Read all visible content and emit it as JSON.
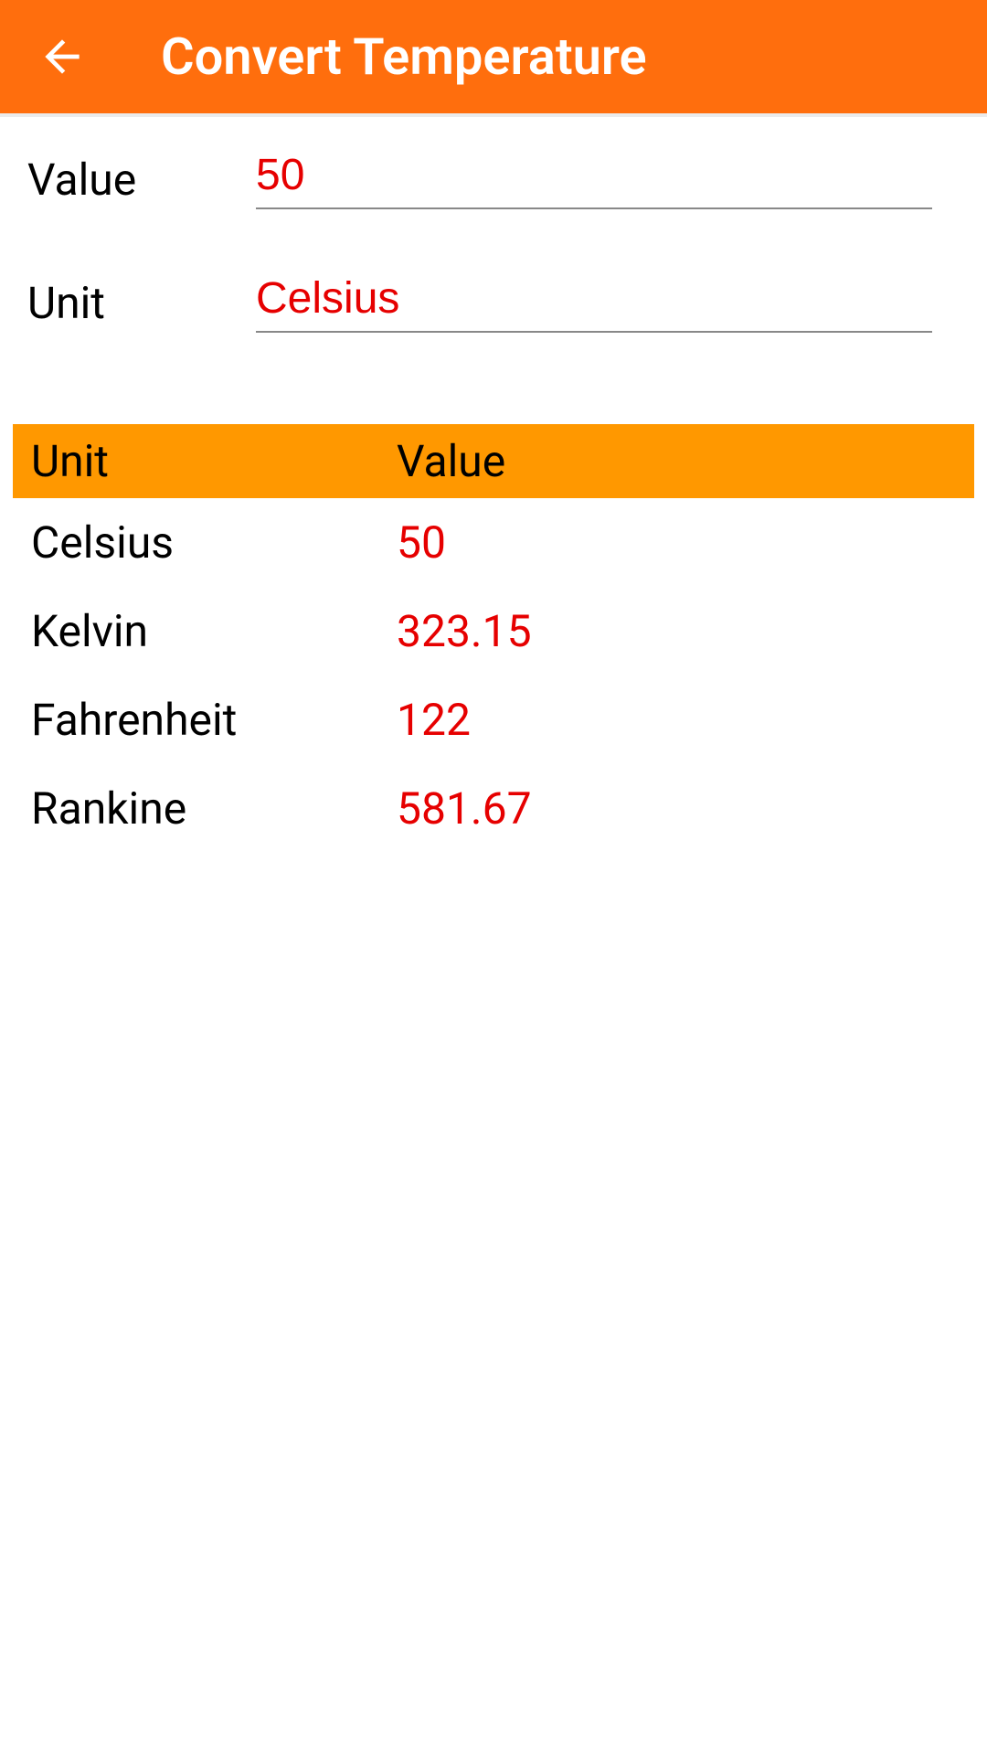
{
  "header": {
    "title": "Convert Temperature"
  },
  "form": {
    "value_label": "Value",
    "value_input": "50",
    "unit_label": "Unit",
    "unit_input": "Celsius"
  },
  "table": {
    "header": {
      "unit": "Unit",
      "value": "Value"
    },
    "rows": [
      {
        "unit": "Celsius",
        "value": "50"
      },
      {
        "unit": "Kelvin",
        "value": "323.15"
      },
      {
        "unit": "Fahrenheit",
        "value": "122"
      },
      {
        "unit": "Rankine",
        "value": "581.67"
      }
    ]
  }
}
